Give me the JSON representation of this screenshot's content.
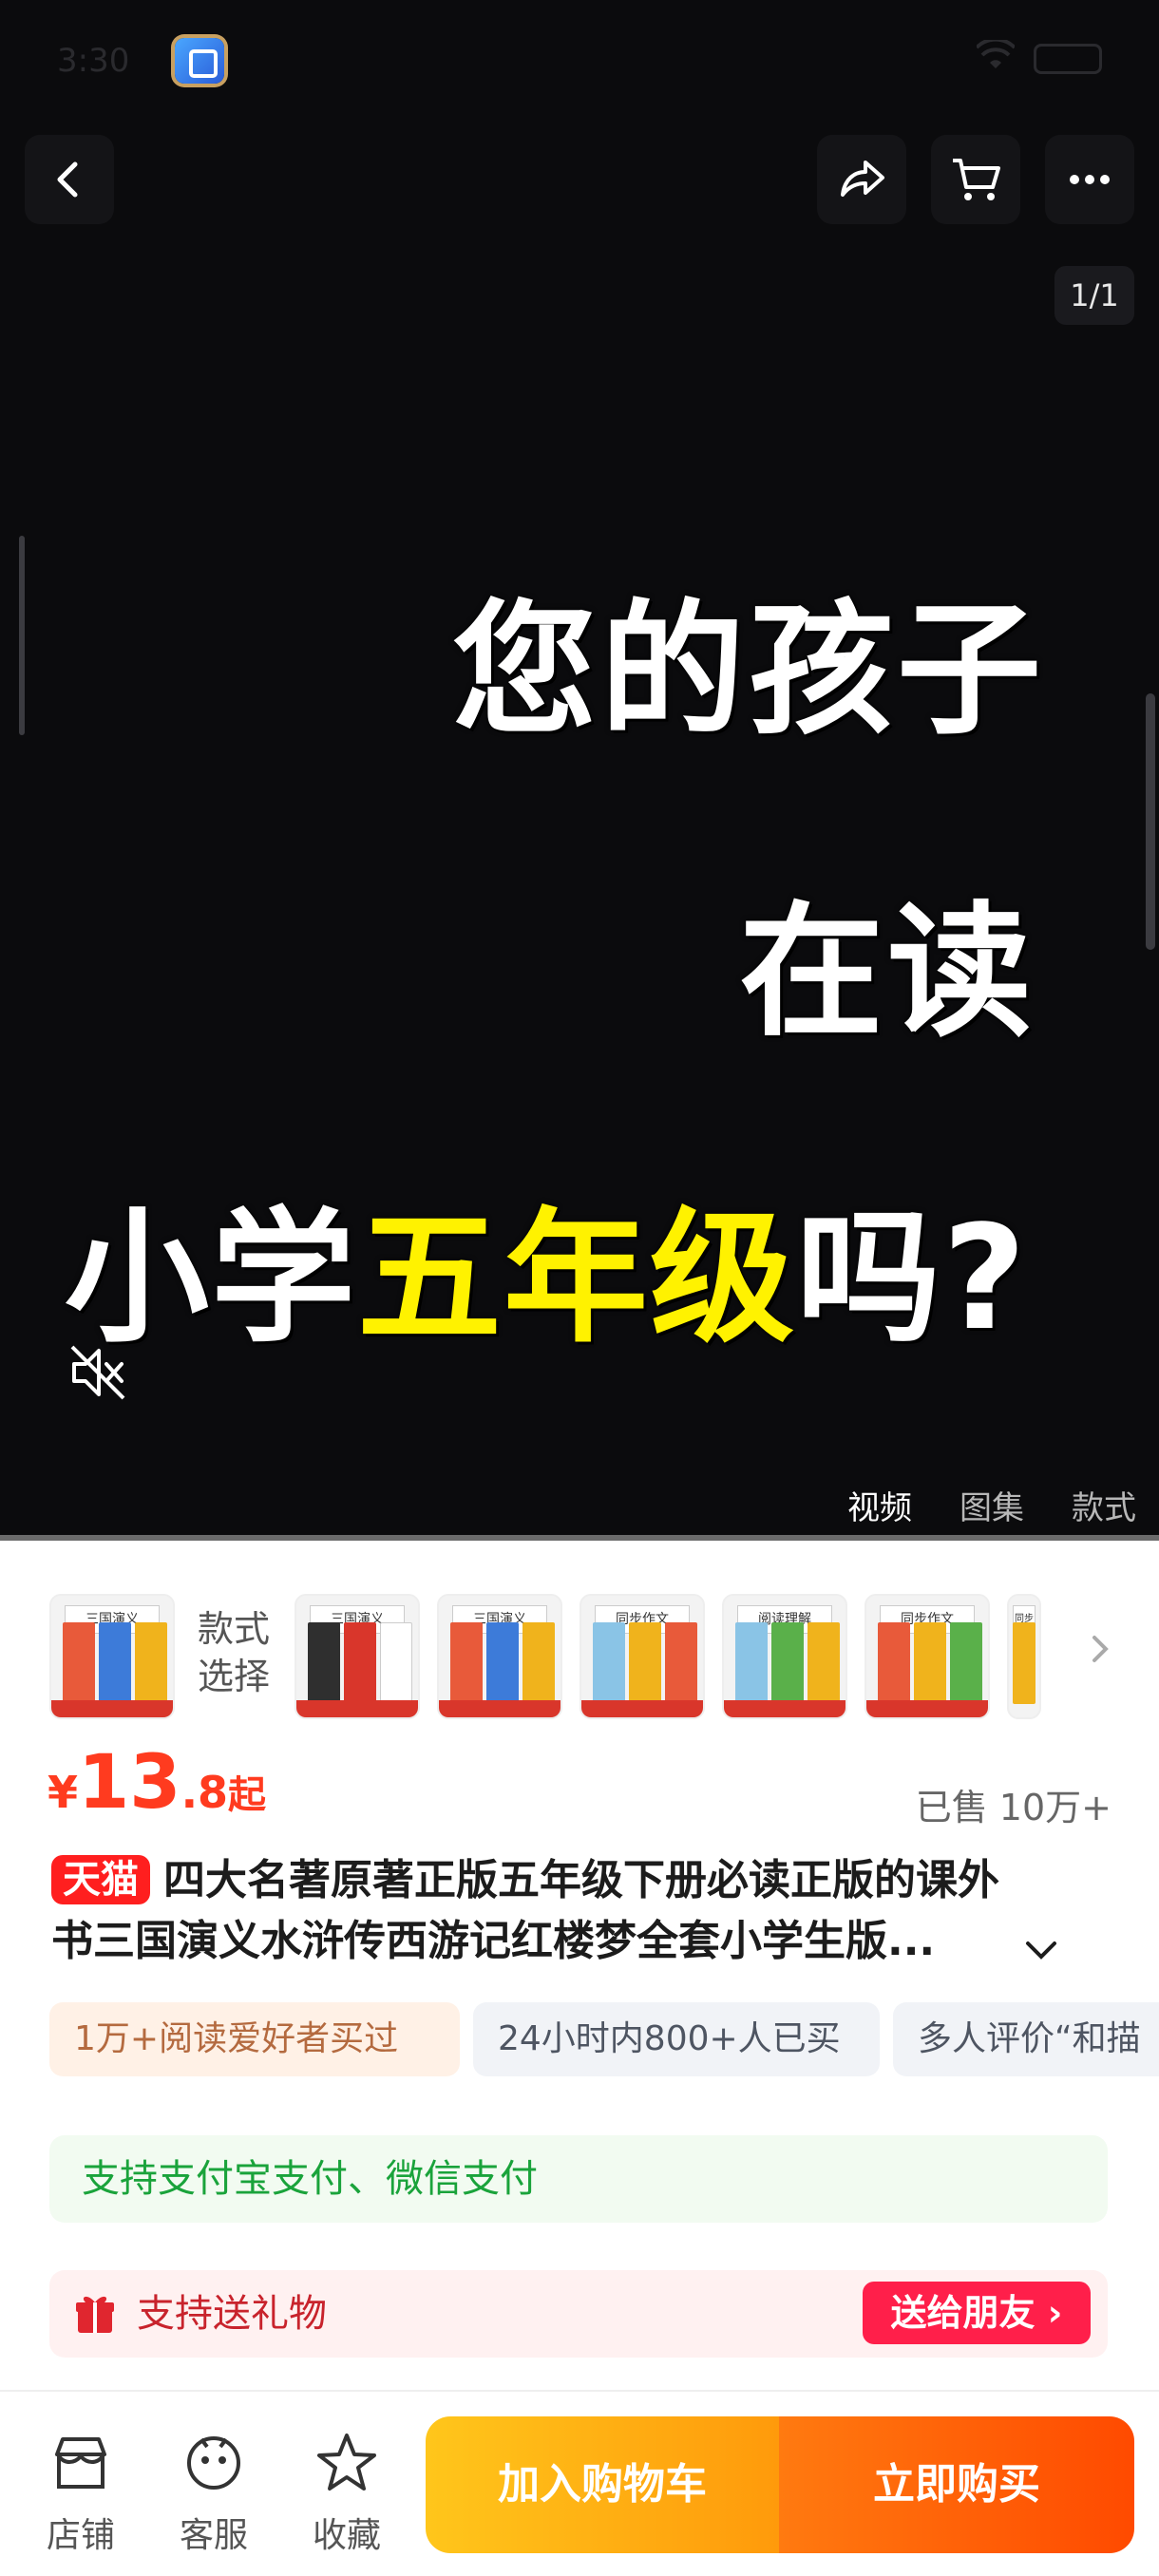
{
  "status_bar": {
    "time": "3:30"
  },
  "media": {
    "counter": "1/1",
    "headline": {
      "line1": "您的孩子",
      "line2": "在读",
      "line3_white_a": "小学",
      "line3_yellow": "五年级",
      "line3_white_b": "吗?"
    },
    "tabs": [
      "视频",
      "图集",
      "款式"
    ],
    "active_tab": "视频",
    "colors": {
      "background": "#0b0b0d",
      "highlight": "#fff200"
    }
  },
  "variants": {
    "label": "款式选择",
    "thumbs": [
      "三国演义",
      "三国演义",
      "三国演义",
      "同步作文",
      "阅读理解",
      "同步作文",
      "同步作文"
    ]
  },
  "price": {
    "currency": "¥",
    "integer": "13",
    "decimal": ".8",
    "suffix": "起",
    "sold": "已售 10万+",
    "color": "#ff3b1f"
  },
  "product": {
    "badge": "天猫",
    "title_line1": "四大名著原著正版五年级下册必读正版的课外",
    "title_line2": "书三国演义水浒传西游记红楼梦全套小学生版..."
  },
  "tags": [
    "1万+阅读爱好者买过",
    "24小时内800+人已买",
    "多人评价“和描"
  ],
  "payment": {
    "text": "支持支付宝支付、微信支付"
  },
  "gift": {
    "text": "支持送礼物",
    "button": "送给朋友 ›"
  },
  "bottom_bar": {
    "shop": "店铺",
    "service": "客服",
    "favorite": "收藏",
    "add_to_cart": "加入购物车",
    "buy_now": "立即购买"
  }
}
